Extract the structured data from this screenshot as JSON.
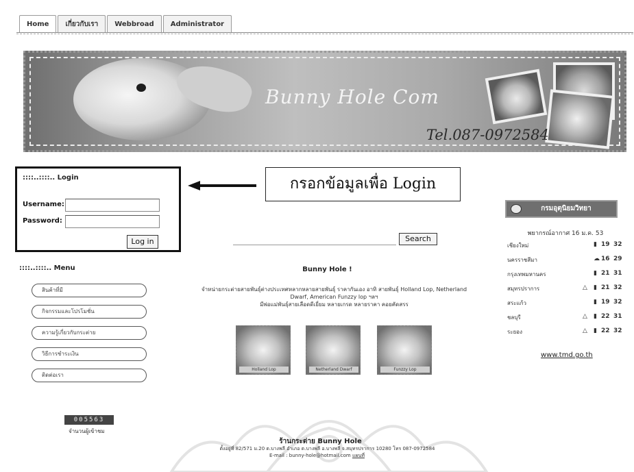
{
  "tabs": [
    {
      "label": "Home"
    },
    {
      "label": "เกี่ยวกับเรา"
    },
    {
      "label": "Webbroad"
    },
    {
      "label": "Administrator"
    }
  ],
  "banner": {
    "title": "Bunny Hole Com",
    "tel": "Tel.087-0972584"
  },
  "login": {
    "title": "::::..::::.. Login",
    "username_label": "Username:",
    "password_label": "Password:",
    "button_label": "Log in"
  },
  "annotation": {
    "callout_text": "กรอกข้อมูลเพื่อ Login"
  },
  "search": {
    "button_label": "Search"
  },
  "menu": {
    "title": "::::..::::.. Menu",
    "items": [
      {
        "label": "สินค้าที่มี"
      },
      {
        "label": "กิจกรรมและโปรโมชั่น"
      },
      {
        "label": "ความรู้เกี่ยวกับกระต่าย"
      },
      {
        "label": "วิธีการชำระเงิน"
      },
      {
        "label": "ติดต่อเรา"
      }
    ]
  },
  "center": {
    "title": "Bunny Hole !",
    "text_line1": "จำหน่ายกระต่ายสายพันธุ์ต่างประเทศหลากหลายสายพันธุ์ ราคากันเอง อาทิ สายพันธุ์ Holland Lop, Netherland",
    "text_line2": "Dwarf, American Funzzy lop ฯลฯ",
    "text_line3": "มีพ่อแม่พันธุ์สายเลือดดีเยี่ยม หลายเกรด หลายราคา คอยคัดสรร",
    "thumbs": [
      {
        "caption": "Holland Lop"
      },
      {
        "caption": "Netherland Dwarf"
      },
      {
        "caption": "Funzzy Lop"
      }
    ]
  },
  "weather": {
    "header": "กรมอุตุนิยมวิทยา",
    "date": "พยากรณ์อากาศ 16 ม.ค. 53",
    "rows": [
      {
        "city": "เชียงใหม่",
        "icon": "thermometer-icon",
        "tmin": "19",
        "tmax": "32"
      },
      {
        "city": "นครราชสีมา",
        "icon": "cloud-icon",
        "tmin": "16",
        "tmax": "29"
      },
      {
        "city": "กรุงเทพมหานคร",
        "icon": "thermometer-icon",
        "tmin": "21",
        "tmax": "31"
      },
      {
        "city": "สมุทรปราการ",
        "icon": "sun-icon",
        "tmin": "21",
        "tmax": "32"
      },
      {
        "city": "สระแก้ว",
        "icon": "thermometer-icon",
        "tmin": "19",
        "tmax": "32"
      },
      {
        "city": "ชลบุรี",
        "icon": "sun-icon",
        "tmin": "22",
        "tmax": "31"
      },
      {
        "city": "ระยอง",
        "icon": "sun-icon",
        "tmin": "22",
        "tmax": "32"
      }
    ],
    "link": "www.tmd.go.th"
  },
  "counter": {
    "value": "005563",
    "label": "จำนวนผู้เข้าชม"
  },
  "footer": {
    "title": "ร้านกระต่าย Bunny Hole",
    "address": "ตั้งอยู่ที่ 82/571 ม.20 ต.บางพลี อำเภอ ต.บางพลี อ.บางพลี จ.สมุทรปราการ 10280 โทร 087-0972584",
    "email": "E-mail : bunny-hole@hotmail.com",
    "map_link": "แผนที่"
  }
}
